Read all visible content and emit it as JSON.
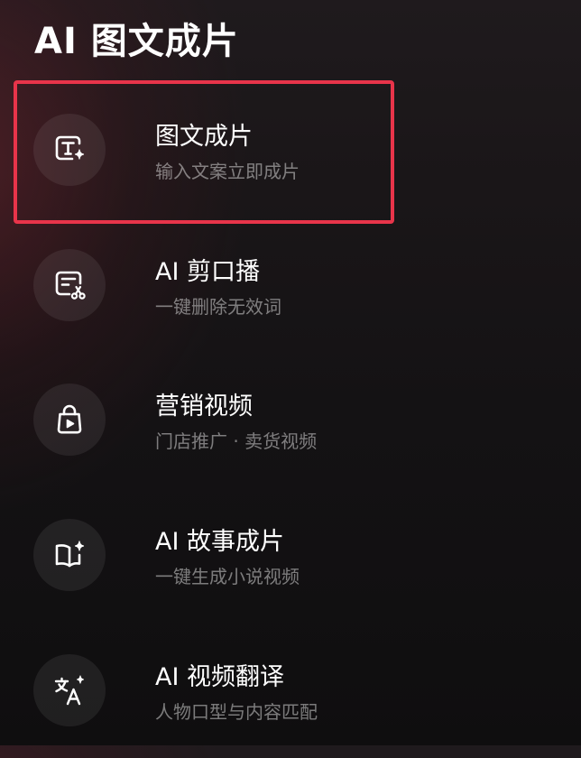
{
  "page": {
    "title": "AI 图文成片"
  },
  "highlight_color": "#e8344a",
  "menu": {
    "items": [
      {
        "icon": "text-sparkle-icon",
        "title": "图文成片",
        "subtitle": "输入文案立即成片"
      },
      {
        "icon": "document-scissors-icon",
        "title": "AI 剪口播",
        "subtitle": "一键删除无效词"
      },
      {
        "icon": "shopping-bag-play-icon",
        "title": "营销视频",
        "subtitle": "门店推广 · 卖货视频"
      },
      {
        "icon": "book-sparkle-icon",
        "title": "AI 故事成片",
        "subtitle": "一键生成小说视频"
      },
      {
        "icon": "translate-icon",
        "title": "AI 视频翻译",
        "subtitle": "人物口型与内容匹配"
      }
    ]
  }
}
